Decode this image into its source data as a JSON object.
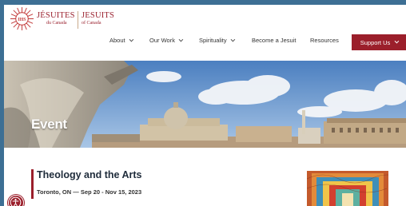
{
  "brand": {
    "name_fr": "JÉSUITES",
    "sub_fr": "du Canada",
    "name_en": "JESUITS",
    "sub_en": "of Canada",
    "color": "#9b2330"
  },
  "nav": {
    "items": [
      {
        "label": "About",
        "has_dropdown": true
      },
      {
        "label": "Our Work",
        "has_dropdown": true
      },
      {
        "label": "Spirituality",
        "has_dropdown": true
      },
      {
        "label": "Become a Jesuit",
        "has_dropdown": false
      },
      {
        "label": "Resources",
        "has_dropdown": false
      }
    ],
    "support_label": "Support Us",
    "support_color": "#9b1f2b"
  },
  "hero": {
    "title": "Event"
  },
  "event": {
    "title": "Theology and the Arts",
    "meta": "Toronto, ON — Sep 20 - Nov 15, 2023"
  },
  "icons": {
    "accessibility": "accessibility-icon",
    "chevron": "chevron-down-icon"
  }
}
